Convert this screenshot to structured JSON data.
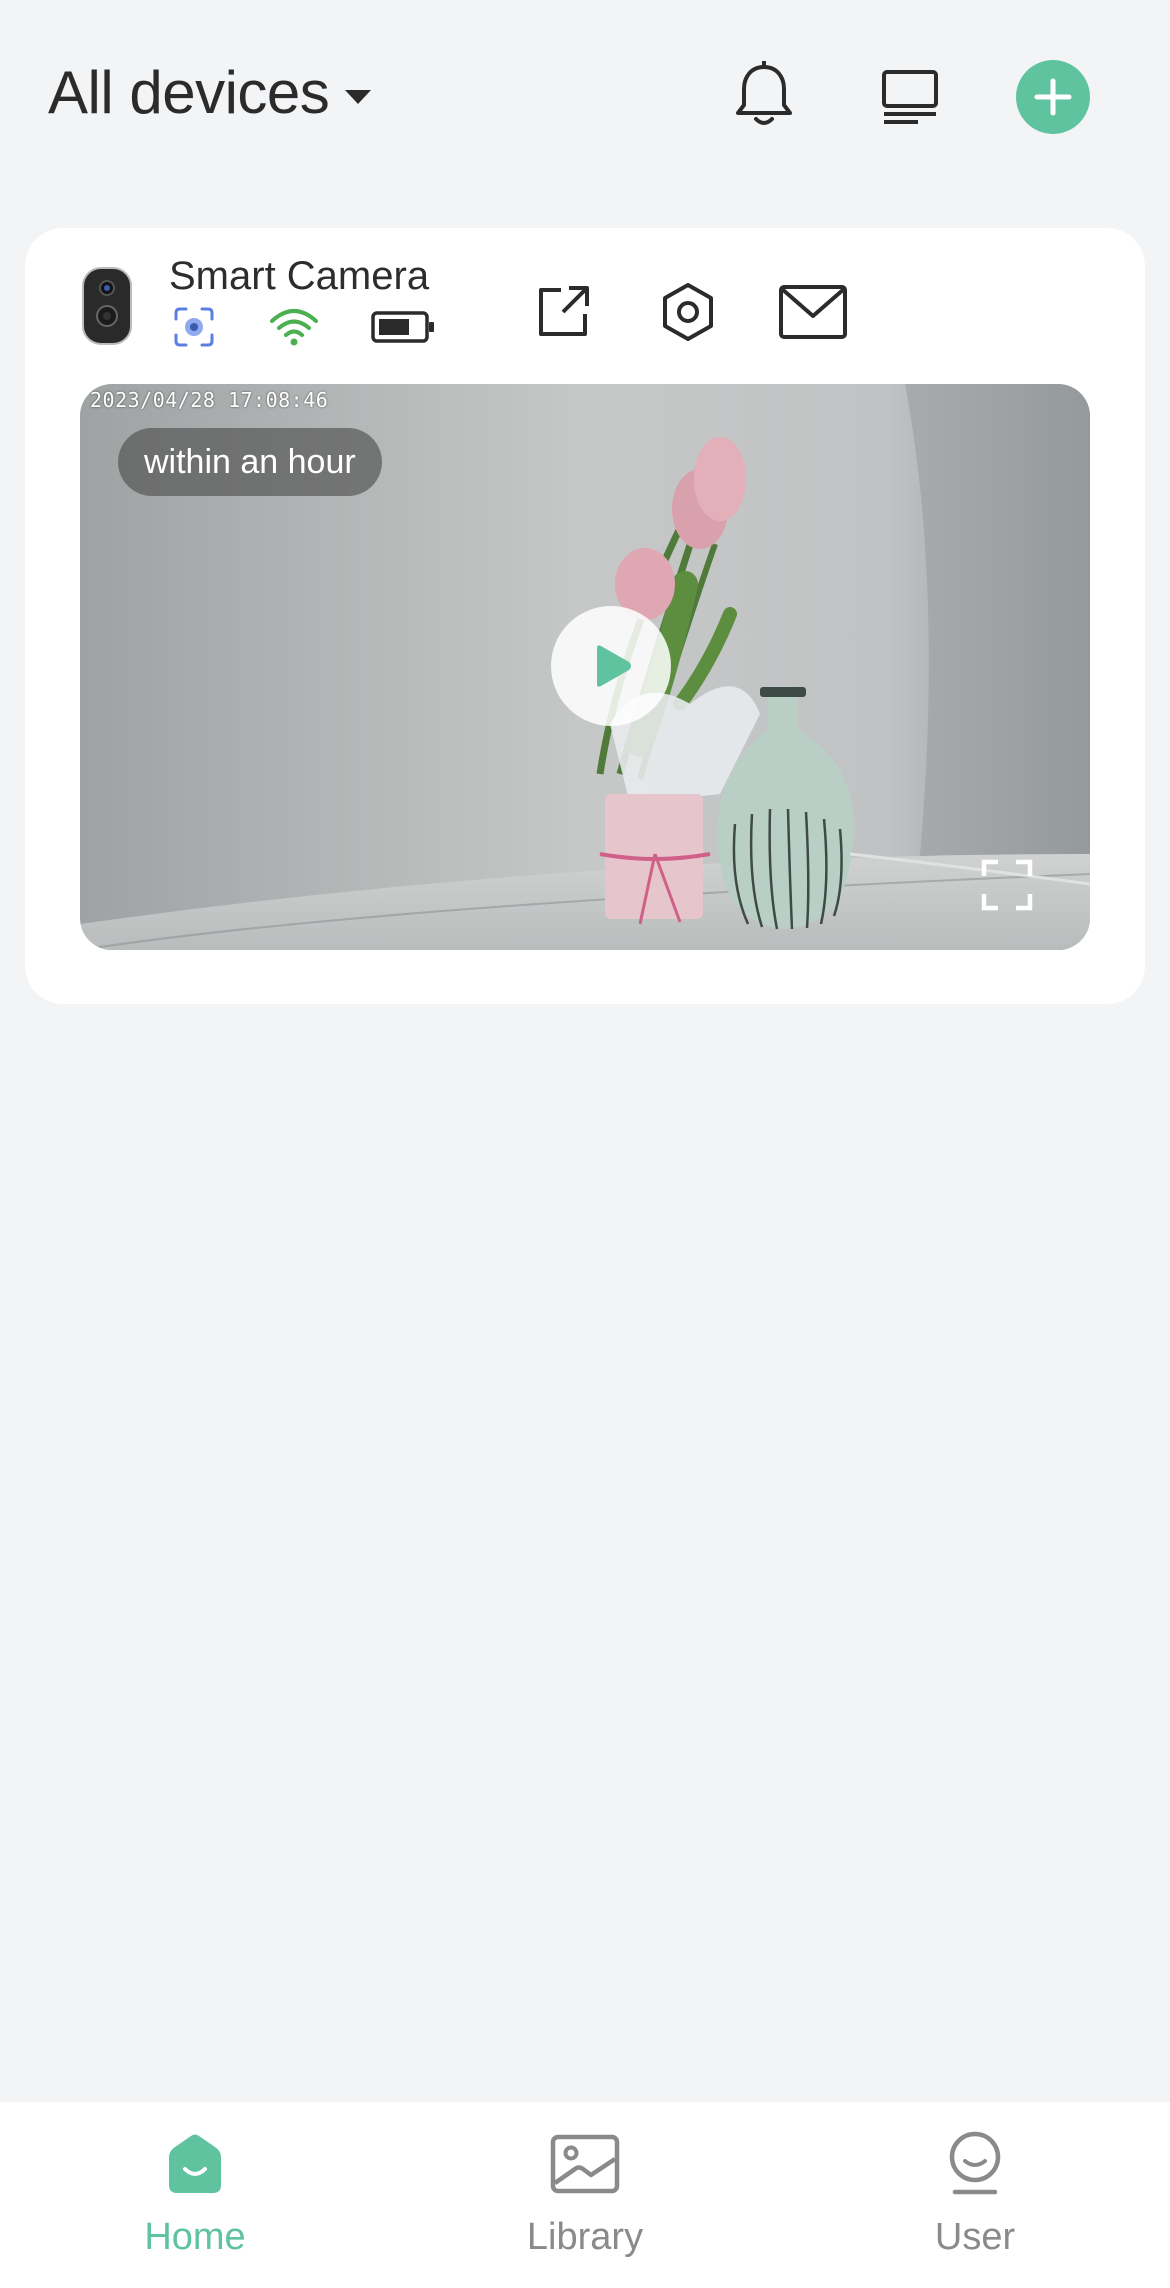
{
  "header": {
    "title": "All devices",
    "icons": [
      "bell-icon",
      "device-list-icon",
      "plus-icon"
    ]
  },
  "device": {
    "name": "Smart Camera",
    "status_icons": [
      "motion-detection-icon",
      "wifi-icon",
      "battery-icon"
    ],
    "actions": [
      "share-icon",
      "settings-icon",
      "message-icon"
    ],
    "preview": {
      "timestamp": "2023/04/28  17:08:46",
      "badge": "within an hour"
    }
  },
  "tabs": [
    {
      "label": "Home",
      "icon": "home-icon",
      "active": true
    },
    {
      "label": "Library",
      "icon": "library-icon",
      "active": false
    },
    {
      "label": "User",
      "icon": "user-icon",
      "active": false
    }
  ],
  "colors": {
    "accent": "#5fc3a0",
    "background": "#f3f4f6",
    "inactive_tab": "#8a8a8a",
    "wifi": "#4caf50",
    "motion": "#5b7fe0"
  }
}
